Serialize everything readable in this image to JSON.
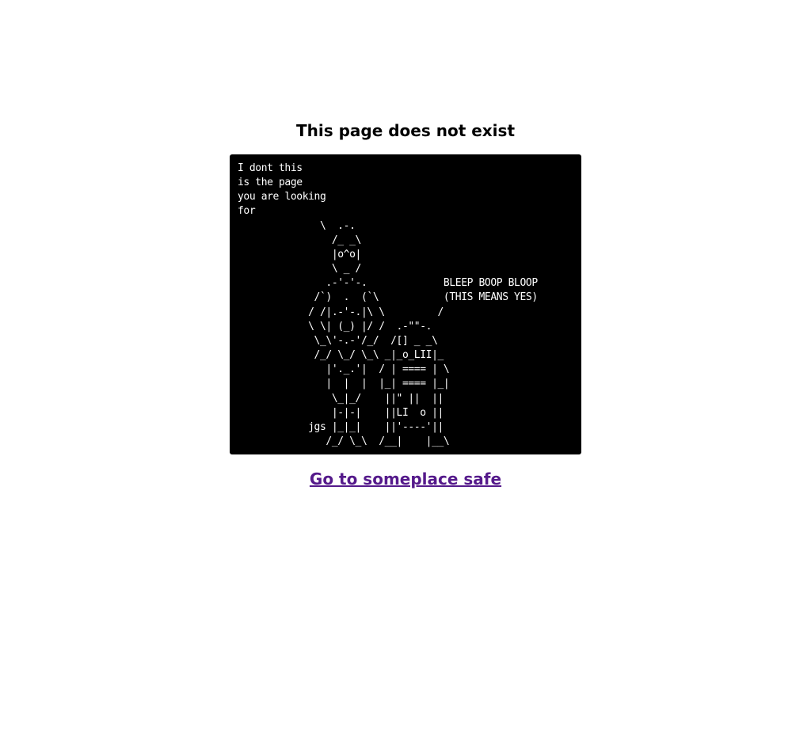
{
  "page": {
    "title": "This page does not exist",
    "ascii_art": "I dont this\nis the page\nyou are looking\nfor\n              \\  .-.\n                /_ _\\\n                |o^o|\n                \\ _ /\n               .-'-'-.             BLEEP BOOP BLOOP\n             /`)  .  (`\\           (THIS MEANS YES)\n            / /|.-'-.|\\ \\         /\n            \\ \\| (_) |/ /  .-\"\"-.\n             \\_\\'-.-'/_/  /[] _ _\\\n             /_/ \\_/ \\_\\ _|_o_LII|_\n               |'._.'|  / | ==== | \\\n               |  |  |  |_| ==== |_|\n                \\_|_/    ||\" ||  ||\n                |-|-|    ||LI  o ||\n            jgs |_|_|    ||'----'||\n               /_/ \\_\\  /__|    |__\\",
    "link_text": "Go to someplace safe",
    "link_color": "#551a8b",
    "box_color": "#000000",
    "art_color": "#ffffff"
  }
}
